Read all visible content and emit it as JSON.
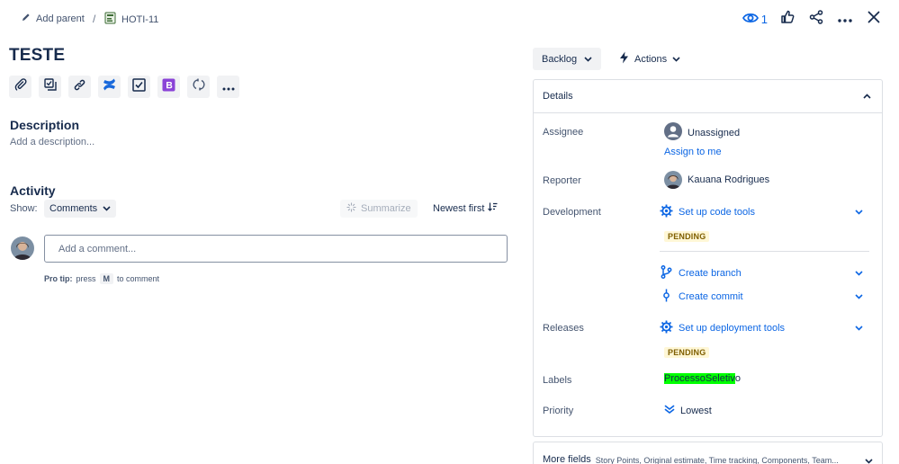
{
  "breadcrumb": {
    "add_parent": "Add parent",
    "separator": "/",
    "issue_key": "HOTI-11"
  },
  "top_actions": {
    "watch_count": "1"
  },
  "issue": {
    "title": "TESTE"
  },
  "toolbar": {
    "icons": [
      "attachment-icon",
      "subtask-icon",
      "link-icon",
      "confluence-icon",
      "checklist-icon",
      "app-icon",
      "loop-icon",
      "more-icon"
    ]
  },
  "description": {
    "heading": "Description",
    "placeholder": "Add a description..."
  },
  "activity": {
    "heading": "Activity",
    "show_label": "Show:",
    "filter": "Comments",
    "summarize": "Summarize",
    "sort": "Newest first",
    "comment_placeholder": "Add a comment...",
    "protip_prefix": "Pro tip:",
    "protip_press": "press",
    "protip_key": "M",
    "protip_suffix": "to comment"
  },
  "status": {
    "label": "Backlog"
  },
  "actions": {
    "label": "Actions"
  },
  "details": {
    "heading": "Details",
    "assignee": {
      "label": "Assignee",
      "value": "Unassigned",
      "assign_link": "Assign to me"
    },
    "reporter": {
      "label": "Reporter",
      "value": "Kauana Rodrigues"
    },
    "development": {
      "label": "Development",
      "setup": "Set up code tools",
      "pending": "PENDING",
      "create_branch": "Create branch",
      "create_commit": "Create commit"
    },
    "releases": {
      "label": "Releases",
      "setup": "Set up deployment tools",
      "pending": "PENDING"
    },
    "labels": {
      "label": "Labels",
      "highlighted": "ProcessoSeletiv",
      "rest": "o"
    },
    "priority": {
      "label": "Priority",
      "value": "Lowest"
    }
  },
  "more_fields": {
    "heading": "More fields",
    "sub": "Story Points, Original estimate, Time tracking, Components, Team..."
  },
  "colors": {
    "link": "#0c66e4",
    "label_highlight": "#00ff00",
    "pending_bg": "#fff7d6",
    "pending_text": "#7f5f01"
  }
}
